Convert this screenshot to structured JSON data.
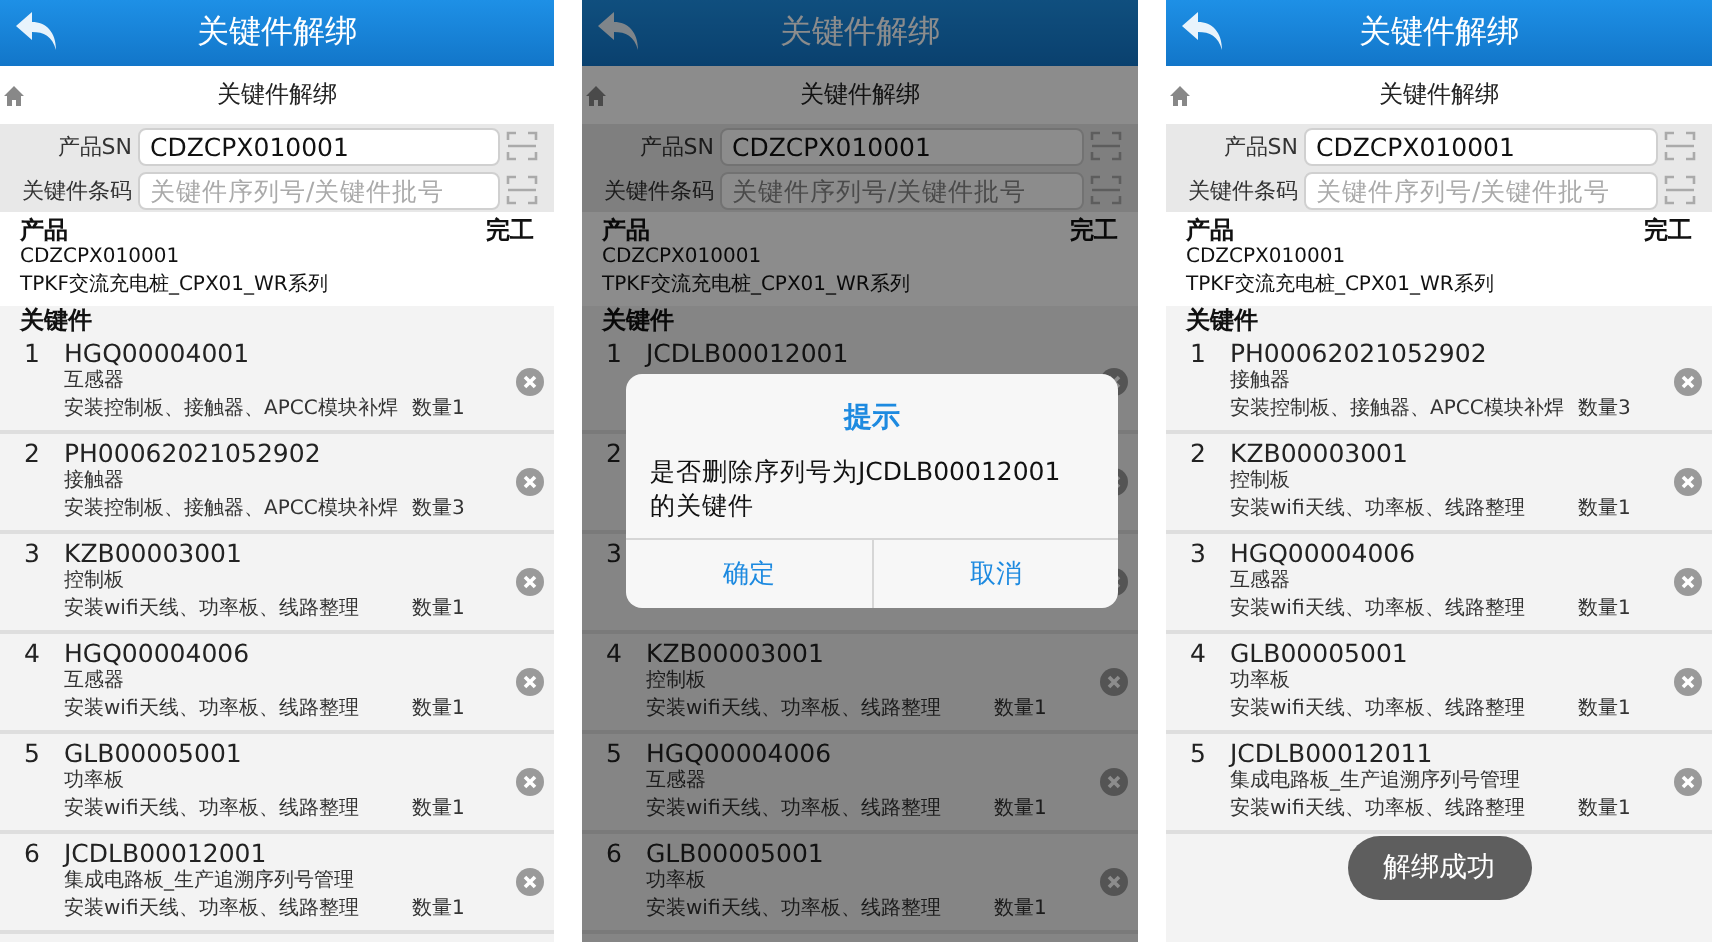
{
  "screens": [
    {
      "title": "关键件解绑",
      "subtitle": "关键件解绑",
      "dimmed": false,
      "form": [
        {
          "label": "产品SN",
          "value": "CDZCPX010001"
        },
        {
          "label": "关键件条码",
          "placeholder": "关键件序列号/关键件批号"
        }
      ],
      "product": {
        "heading": "产品",
        "status": "完工",
        "code": "CDZCPX010001",
        "name": "TPKF交流充电桩_CPX01_WR系列"
      },
      "list_heading": "关键件",
      "items": [
        {
          "index": "1",
          "code": "HGQ00004001",
          "name": "互感器",
          "desc": "安装控制板、接触器、APCC模块补焊",
          "qty": "数量1"
        },
        {
          "index": "2",
          "code": "PH00062021052902",
          "name": "接触器",
          "desc": "安装控制板、接触器、APCC模块补焊",
          "qty": "数量3"
        },
        {
          "index": "3",
          "code": "KZB00003001",
          "name": "控制板",
          "desc": "安装wifi天线、功率板、线路整理",
          "qty": "数量1"
        },
        {
          "index": "4",
          "code": "HGQ00004006",
          "name": "互感器",
          "desc": "安装wifi天线、功率板、线路整理",
          "qty": "数量1"
        },
        {
          "index": "5",
          "code": "GLB00005001",
          "name": "功率板",
          "desc": "安装wifi天线、功率板、线路整理",
          "qty": "数量1"
        },
        {
          "index": "6",
          "code": "JCDLB00012001",
          "name": "集成电路板_生产追溯序列号管理",
          "desc": "安装wifi天线、功率板、线路整理",
          "qty": "数量1"
        }
      ]
    },
    {
      "title": "关键件解绑",
      "subtitle": "关键件解绑",
      "dimmed": true,
      "form": [
        {
          "label": "产品SN",
          "value": "CDZCPX010001"
        },
        {
          "label": "关键件条码",
          "placeholder": "关键件序列号/关键件批号"
        }
      ],
      "product": {
        "heading": "产品",
        "status": "完工",
        "code": "CDZCPX010001",
        "name": "TPKF交流充电桩_CPX01_WR系列"
      },
      "list_heading": "关键件",
      "items": [
        {
          "index": "1",
          "code": "JCDLB00012001"
        },
        {
          "index": "2"
        },
        {
          "index": "3"
        },
        {
          "index": "4",
          "code": "KZB00003001",
          "name": "控制板",
          "desc": "安装wifi天线、功率板、线路整理",
          "qty": "数量1"
        },
        {
          "index": "5",
          "code": "HGQ00004006",
          "name": "互感器",
          "desc": "安装wifi天线、功率板、线路整理",
          "qty": "数量1"
        },
        {
          "index": "6",
          "code": "GLB00005001",
          "name": "功率板",
          "desc": "安装wifi天线、功率板、线路整理",
          "qty": "数量1"
        }
      ],
      "dialog": {
        "title": "提示",
        "message": "是否删除序列号为JCDLB00012001的关键件",
        "buttons": [
          "确定",
          "取消"
        ]
      }
    },
    {
      "title": "关键件解绑",
      "subtitle": "关键件解绑",
      "dimmed": false,
      "form": [
        {
          "label": "产品SN",
          "value": "CDZCPX010001"
        },
        {
          "label": "关键件条码",
          "placeholder": "关键件序列号/关键件批号"
        }
      ],
      "product": {
        "heading": "产品",
        "status": "完工",
        "code": "CDZCPX010001",
        "name": "TPKF交流充电桩_CPX01_WR系列"
      },
      "list_heading": "关键件",
      "items": [
        {
          "index": "1",
          "code": "PH00062021052902",
          "name": "接触器",
          "desc": "安装控制板、接触器、APCC模块补焊",
          "qty": "数量3"
        },
        {
          "index": "2",
          "code": "KZB00003001",
          "name": "控制板",
          "desc": "安装wifi天线、功率板、线路整理",
          "qty": "数量1"
        },
        {
          "index": "3",
          "code": "HGQ00004006",
          "name": "互感器",
          "desc": "安装wifi天线、功率板、线路整理",
          "qty": "数量1"
        },
        {
          "index": "4",
          "code": "GLB00005001",
          "name": "功率板",
          "desc": "安装wifi天线、功率板、线路整理",
          "qty": "数量1"
        },
        {
          "index": "5",
          "code": "JCDLB00012011",
          "name": "集成电路板_生产追溯序列号管理",
          "desc": "安装wifi天线、功率板、线路整理",
          "qty": "数量1"
        }
      ],
      "toast": "解绑成功"
    }
  ]
}
